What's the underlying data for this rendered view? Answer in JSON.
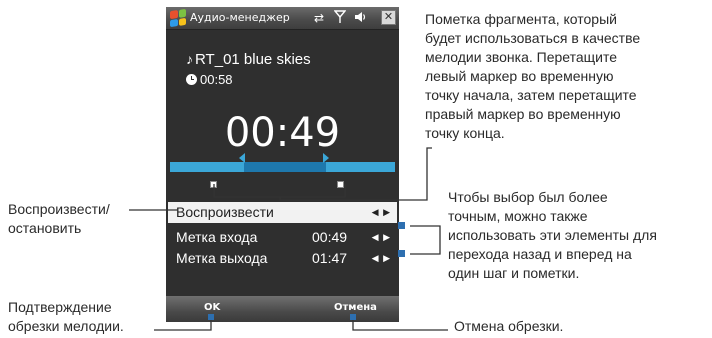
{
  "window": {
    "title": "Аудио-менеджер",
    "icons": [
      "windows-start-icon",
      "connectivity-icon",
      "signal-icon",
      "speaker-icon",
      "close-icon"
    ]
  },
  "track": {
    "name": "RT_01 blue skies",
    "duration": "00:58"
  },
  "current_time": "00:49",
  "menu": {
    "play": {
      "label": "Воспроизвести",
      "selected": true
    },
    "mark_in": {
      "label": "Метка входа",
      "value": "00:49"
    },
    "mark_out": {
      "label": "Метка выхода",
      "value": "01:47"
    },
    "arrows": "◀ ▶"
  },
  "softkeys": {
    "left": "OK",
    "right": "Отмена"
  },
  "annotations": {
    "fragment": [
      "Пометка фрагмента, который",
      "будет использоваться в качестве",
      "мелодии звонка. Перетащите",
      "левый маркер во временную",
      "точку начала, затем перетащите",
      "правый маркер во временную",
      "точку конца."
    ],
    "play_stop": [
      "Воспроизвести/",
      "остановить"
    ],
    "precision": [
      "Чтобы выбор был более",
      "точным, можно также",
      "использовать эти элементы для",
      "перехода назад и вперед на",
      "один шаг и пометки."
    ],
    "confirm": [
      "Подтверждение",
      "обрезки мелодии."
    ],
    "cancel": [
      "Отмена обрезки."
    ]
  },
  "colors": {
    "screen_bg": "#2f2f2f",
    "timeline": "#3ba7d8",
    "timeline_selection": "#1e78ad",
    "selected_row": "#f2f2f2"
  }
}
